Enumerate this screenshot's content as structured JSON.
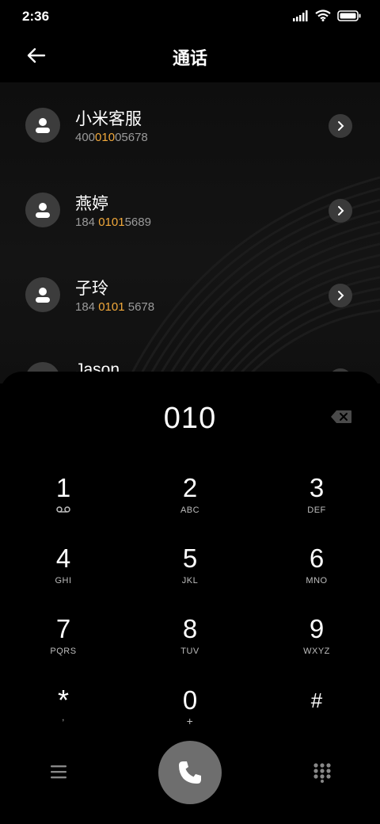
{
  "status": {
    "time": "2:36"
  },
  "header": {
    "title": "通话"
  },
  "contacts": [
    {
      "name": "小米客服",
      "num_pre": "400",
      "num_hl": "010",
      "num_post": "05678"
    },
    {
      "name": "燕婷",
      "num_pre": "184 ",
      "num_hl": "0101",
      "num_post": "5689"
    },
    {
      "name": "子玲",
      "num_pre": "184 ",
      "num_hl": "0101",
      "num_post": " 5678"
    },
    {
      "name": "Jason"
    }
  ],
  "dialer": {
    "typed": "010",
    "keys": [
      {
        "digit": "1",
        "letters": ""
      },
      {
        "digit": "2",
        "letters": "ABC"
      },
      {
        "digit": "3",
        "letters": "DEF"
      },
      {
        "digit": "4",
        "letters": "GHI"
      },
      {
        "digit": "5",
        "letters": "JKL"
      },
      {
        "digit": "6",
        "letters": "MNO"
      },
      {
        "digit": "7",
        "letters": "PQRS"
      },
      {
        "digit": "8",
        "letters": "TUV"
      },
      {
        "digit": "9",
        "letters": "WXYZ"
      },
      {
        "digit": "*",
        "letters": ","
      },
      {
        "digit": "0",
        "letters": "+"
      },
      {
        "digit": "#",
        "letters": ""
      }
    ]
  },
  "colors": {
    "highlight": "#f2a93b",
    "call_button": "#6e6e6e"
  }
}
